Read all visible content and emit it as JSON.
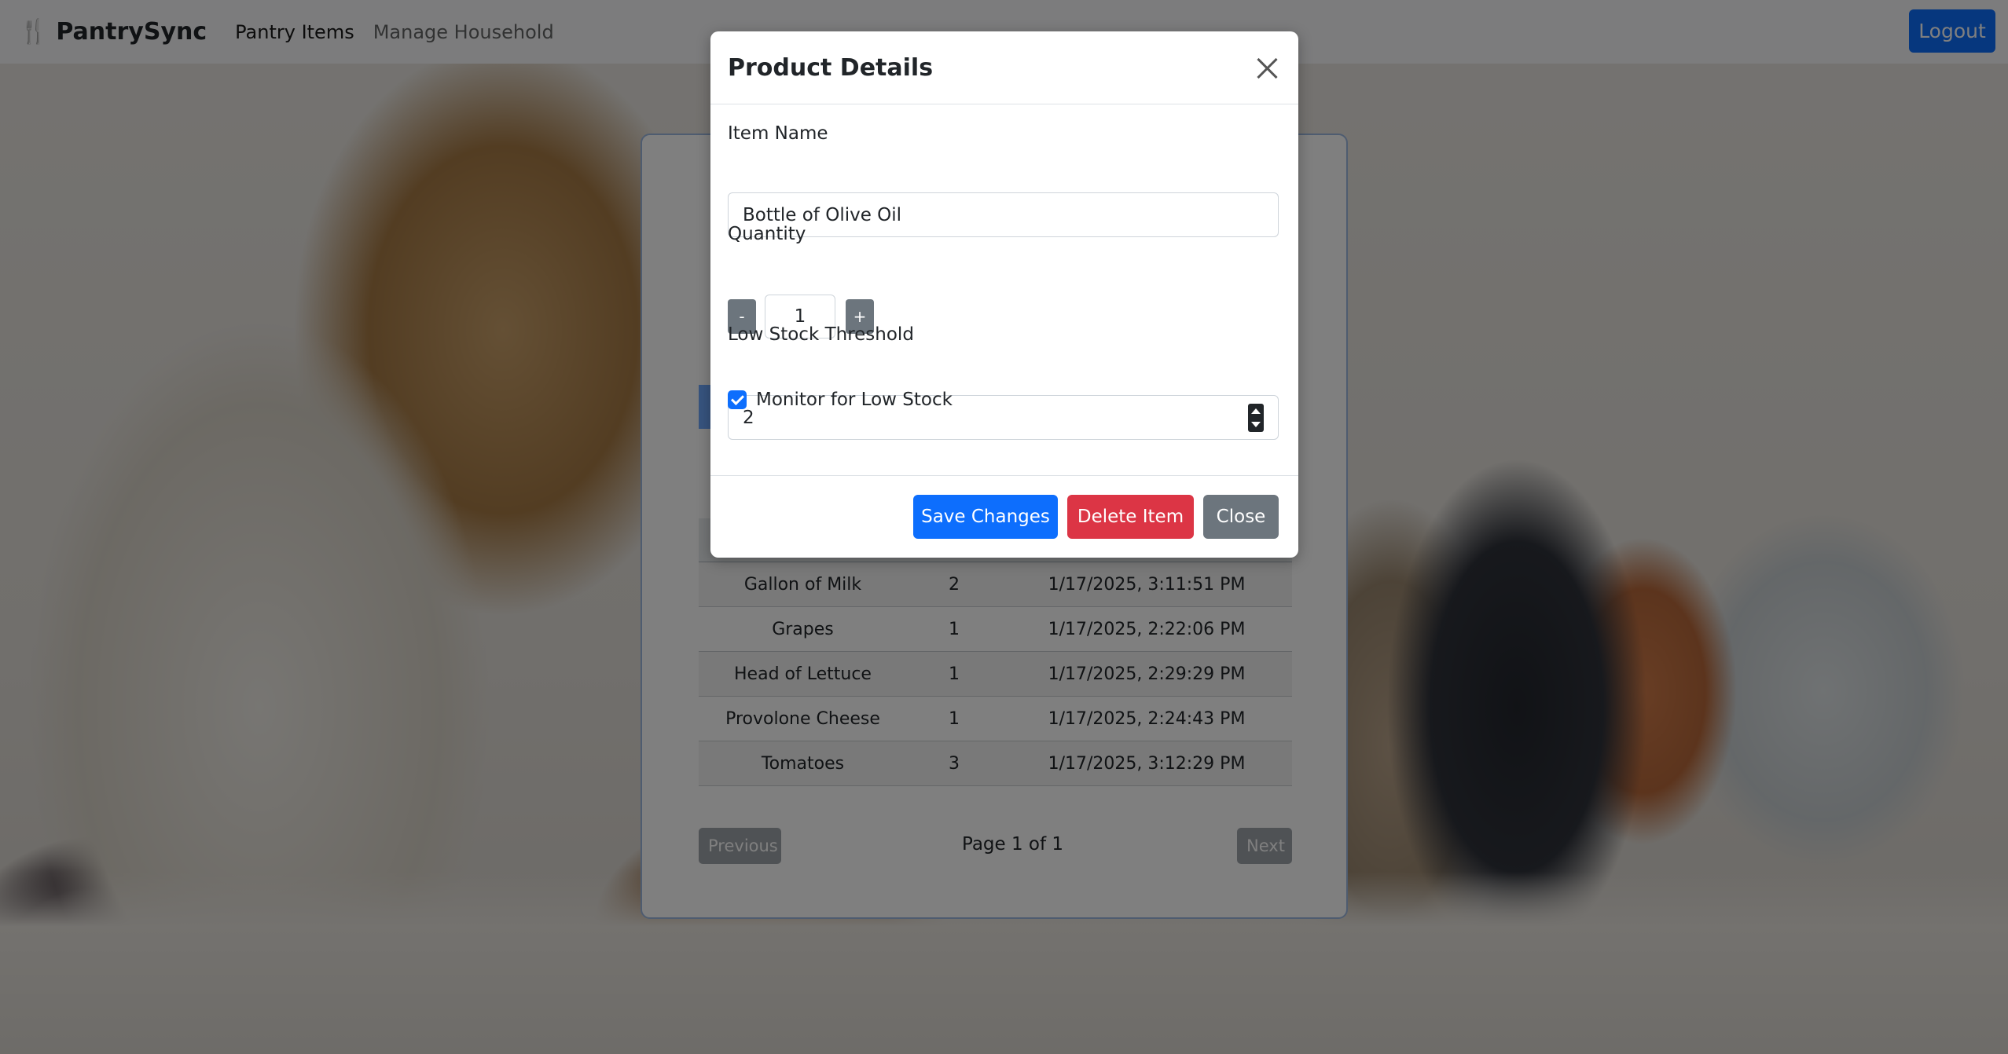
{
  "navbar": {
    "brand": "PantrySync",
    "brand_icon": "fork-knife-icon",
    "links": [
      "Pantry Items",
      "Manage Household"
    ],
    "logout_label": "Logout"
  },
  "table": {
    "rows": [
      {
        "name": "Gallon of Milk",
        "qty": "2",
        "date": "1/17/2025, 3:11:51 PM"
      },
      {
        "name": "Grapes",
        "qty": "1",
        "date": "1/17/2025, 2:22:06 PM"
      },
      {
        "name": "Head of Lettuce",
        "qty": "1",
        "date": "1/17/2025, 2:29:29 PM"
      },
      {
        "name": "Provolone Cheese",
        "qty": "1",
        "date": "1/17/2025, 2:24:43 PM"
      },
      {
        "name": "Tomatoes",
        "qty": "3",
        "date": "1/17/2025, 3:12:29 PM"
      }
    ]
  },
  "pagination": {
    "previous_label": "Previous",
    "info": "Page 1 of 1",
    "next_label": "Next"
  },
  "modal": {
    "title": "Product Details",
    "item_name_label": "Item Name",
    "item_name_value": "Bottle of Olive Oil",
    "quantity_label": "Quantity",
    "quantity_minus": "-",
    "quantity_value": "1",
    "quantity_plus": "+",
    "threshold_label": "Low Stock Threshold",
    "threshold_value": "2",
    "monitor_label": "Monitor for Low Stock",
    "monitor_checked": true,
    "save_label": "Save Changes",
    "delete_label": "Delete Item",
    "close_label": "Close"
  },
  "colors": {
    "primary": "#0d6efd",
    "danger": "#dc3545",
    "secondary": "#6c757d"
  }
}
